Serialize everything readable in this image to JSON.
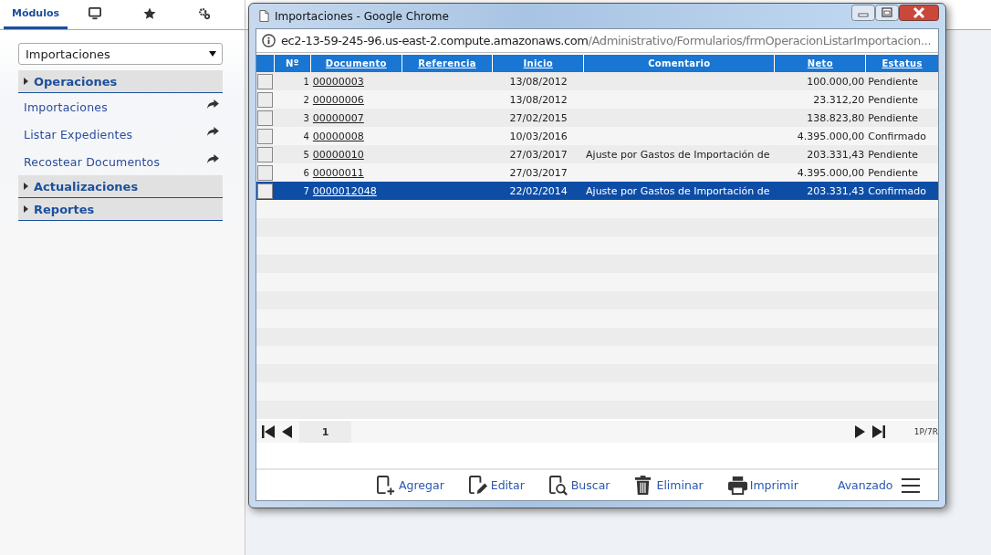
{
  "sidebar": {
    "tabs": [
      {
        "label": "Módulos",
        "selected": true
      },
      {
        "selected": false
      },
      {
        "selected": false
      },
      {
        "selected": false
      }
    ],
    "module_select": {
      "value": "Importaciones"
    },
    "sections": [
      {
        "label": "Operaciones",
        "items": [
          "Importaciones",
          "Listar Expedientes",
          "Recostear Documentos"
        ]
      },
      {
        "label": "Actualizaciones"
      },
      {
        "label": "Reportes"
      }
    ]
  },
  "popup": {
    "window": {
      "title": "Importaciones - Google Chrome"
    },
    "address": {
      "host": "ec2-13-59-245-96.us-east-2.compute.amazonaws.com",
      "path": "/Administrativo/Formularios/frmOperacionListarImportacion..."
    },
    "table": {
      "columns": [
        {
          "label": "Nº",
          "sortable": false
        },
        {
          "label": "Documento",
          "sortable": true
        },
        {
          "label": "Referencia",
          "sortable": true
        },
        {
          "label": "Inicio",
          "sortable": true
        },
        {
          "label": "Comentario",
          "sortable": false
        },
        {
          "label": "Neto",
          "sortable": true
        },
        {
          "label": "Estatus",
          "sortable": true
        }
      ],
      "rows": [
        {
          "cells": [
            "1",
            "00000003",
            "",
            "13/08/2012",
            "",
            "100.000,00",
            "Pendiente"
          ],
          "selected": false
        },
        {
          "cells": [
            "2",
            "00000006",
            "",
            "13/08/2012",
            "",
            "23.312,20",
            "Pendiente"
          ],
          "selected": false
        },
        {
          "cells": [
            "3",
            "00000007",
            "",
            "27/02/2015",
            "",
            "138.823,80",
            "Pendiente"
          ],
          "selected": false
        },
        {
          "cells": [
            "4",
            "00000008",
            "",
            "10/03/2016",
            "",
            "4.395.000,00",
            "Confirmado"
          ],
          "selected": false
        },
        {
          "cells": [
            "5",
            "00000010",
            "",
            "27/03/2017",
            "Ajuste por Gastos de Importación de",
            "203.331,43",
            "Pendiente"
          ],
          "selected": false
        },
        {
          "cells": [
            "6",
            "00000011",
            "",
            "27/03/2017",
            "",
            "4.395.000,00",
            "Pendiente"
          ],
          "selected": false
        },
        {
          "cells": [
            "7",
            "0000012048",
            "",
            "22/02/2014",
            "Ajuste por Gastos de Importación de",
            "203.331,43",
            "Confirmado"
          ],
          "selected": true
        }
      ]
    },
    "pager": {
      "page": "1",
      "summary": "1P/7R"
    },
    "toolbar": {
      "buttons": [
        {
          "label": "Agregar",
          "kind": "add"
        },
        {
          "label": "Editar",
          "kind": "edit"
        },
        {
          "label": "Buscar",
          "kind": "search"
        },
        {
          "label": "Eliminar",
          "kind": "delete"
        },
        {
          "label": "Imprimir",
          "kind": "print"
        }
      ],
      "advanced": "Avanzado"
    }
  }
}
